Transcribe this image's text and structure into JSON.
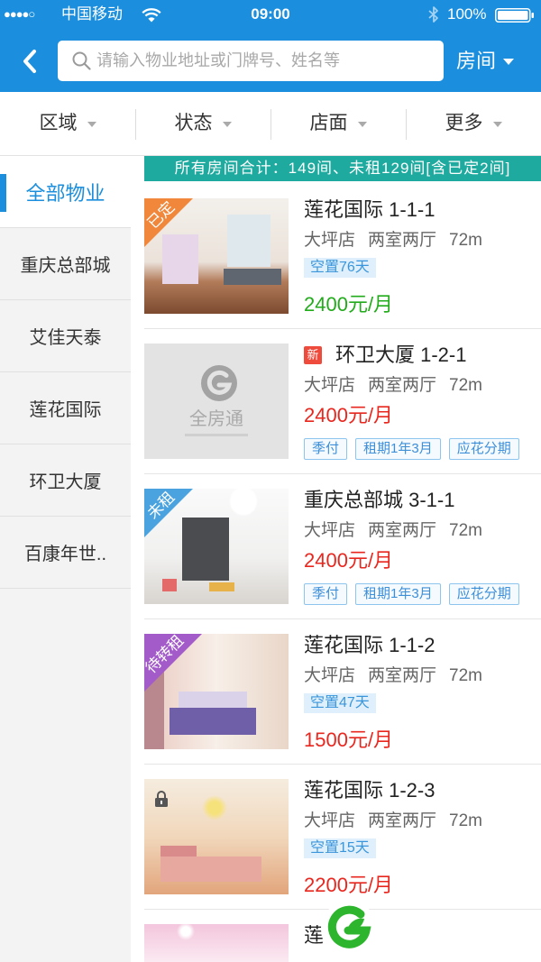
{
  "status_bar": {
    "signal_dots": "●●●●○",
    "carrier": "中国移动",
    "time": "09:00",
    "battery_percent": "100%",
    "icons": [
      "wifi-icon",
      "bluetooth-icon",
      "battery-icon"
    ]
  },
  "nav": {
    "back_icon": "chevron-left-icon",
    "search_icon": "search-icon",
    "search_placeholder": "请输入物业地址或门牌号、姓名等",
    "search_value": "",
    "mode_label": "房间",
    "mode_icon": "caret-down-icon"
  },
  "filters": [
    {
      "label": "区域",
      "icon": "caret-down-icon"
    },
    {
      "label": "状态",
      "icon": "caret-down-icon"
    },
    {
      "label": "店面",
      "icon": "caret-down-icon"
    },
    {
      "label": "更多",
      "icon": "caret-down-icon"
    }
  ],
  "sidebar": {
    "selected_index": 0,
    "items": [
      {
        "label": "全部物业"
      },
      {
        "label": "重庆总部城"
      },
      {
        "label": "艾佳天泰"
      },
      {
        "label": "莲花国际"
      },
      {
        "label": "环卫大厦"
      },
      {
        "label": "百康年世.."
      }
    ]
  },
  "summary": "所有房间合计：149间、未租129间[含已定2间]",
  "listings": [
    {
      "title": "莲花国际 1-1-1",
      "store": "大坪店",
      "layout": "两室两厅",
      "area": "72m",
      "status_ribbon": {
        "text": "已定",
        "color": "#f0873a"
      },
      "vacancy": "空置76天",
      "price": "2400元/月",
      "price_color": "#22ab1b"
    },
    {
      "title": "环卫大厦 1-2-1",
      "badge": "新",
      "store": "大坪店",
      "layout": "两室两厅",
      "area": "72m",
      "photo_placeholder_text": "全房通",
      "price": "2400元/月",
      "price_color": "#e8271f",
      "tags": [
        "季付",
        "租期1年3月",
        "应花分期"
      ]
    },
    {
      "title": "重庆总部城 3-1-1",
      "store": "大坪店",
      "layout": "两室两厅",
      "area": "72m",
      "status_ribbon": {
        "text": "未租",
        "color": "#4aa3df"
      },
      "price": "2400元/月",
      "price_color": "#e8271f",
      "tags": [
        "季付",
        "租期1年3月",
        "应花分期"
      ]
    },
    {
      "title": "莲花国际 1-1-2",
      "store": "大坪店",
      "layout": "两室两厅",
      "area": "72m",
      "status_ribbon": {
        "text": "待转租",
        "color": "#a25bc9"
      },
      "vacancy": "空置47天",
      "price": "1500元/月",
      "price_color": "#e8271f"
    },
    {
      "title": "莲花国际 1-2-3",
      "lock_icon": "lock-icon",
      "store": "大坪店",
      "layout": "两室两厅",
      "area": "72m",
      "vacancy": "空置15天",
      "price": "2200元/月",
      "price_color": "#e8271f"
    },
    {
      "title": "莲"
    }
  ],
  "floating_button_icon": "quanfangtong-logo-icon",
  "colors": {
    "primary": "#1b8fde",
    "summary_bg": "#1eaa9f",
    "price_red": "#e8271f",
    "price_green": "#22ab1b",
    "new_badge": "#ee4b3c"
  }
}
